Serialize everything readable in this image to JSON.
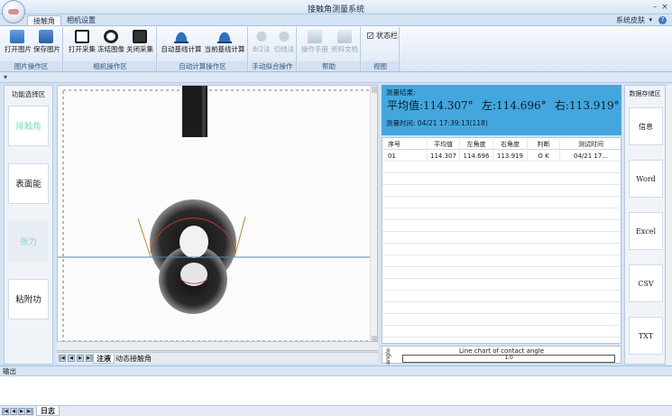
{
  "window": {
    "title": "接触角测量系统",
    "skin_label": "系统皮肤",
    "help_glyph": "?",
    "min_glyph": "–",
    "close_glyph": "×"
  },
  "tabs": [
    {
      "label": "接触角",
      "active": true
    },
    {
      "label": "相机设置",
      "active": false
    }
  ],
  "ribbon": {
    "groups": [
      {
        "label": "图片操作区",
        "buttons": [
          "打开图片",
          "保存图片"
        ]
      },
      {
        "label": "相机操作区",
        "buttons": [
          "打开采集",
          "冻结图像",
          "关闭采集"
        ]
      },
      {
        "label": "自动计算操作区",
        "buttons": [
          "自动基线计算",
          "当前基线计算"
        ]
      },
      {
        "label": "手动拟合操作区",
        "buttons": [
          "θ/2法",
          "切线法"
        ]
      },
      {
        "label": "帮助",
        "buttons": [
          "操作手册",
          "资料文档"
        ]
      },
      {
        "label": "视图",
        "buttons": []
      }
    ],
    "status_checkbox": {
      "label": "状态栏",
      "checked": true,
      "check_glyph": "✓"
    }
  },
  "left_panel": {
    "title": "功能选择区",
    "buttons": [
      {
        "label": "接触角",
        "state": "disabled"
      },
      {
        "label": "表面能",
        "state": "normal"
      },
      {
        "label": "张力",
        "state": "flat"
      },
      {
        "label": "粘附功",
        "state": "normal"
      }
    ]
  },
  "camera_tabs": [
    {
      "label": "注液",
      "active": true
    },
    {
      "label": "动态接触角",
      "active": false
    }
  ],
  "result": {
    "title": "测量结果:",
    "average": "平均值:114.307°",
    "left": "左:114.696°",
    "right": "右:113.919°",
    "time": "测量时间: 04/21 17:39:13(118)"
  },
  "table": {
    "columns": [
      "序号",
      "平均值",
      "左角度",
      "右角度",
      "判断",
      "测试时间"
    ],
    "rows": [
      [
        "01",
        "114.307",
        "114.696",
        "113.919",
        "O K",
        "04/21 17..."
      ]
    ]
  },
  "chart_data": {
    "type": "line",
    "title": "Line chart of contact angle",
    "ylabel": "angle",
    "xlabel": "",
    "y_ticks": [
      "1.0"
    ],
    "series": []
  },
  "right_panel": {
    "title": "数据存储区",
    "buttons": [
      "信息",
      "Word",
      "Excel",
      "CSV",
      "TXT"
    ]
  },
  "output": {
    "title": "输出",
    "tab_label": "日志"
  }
}
